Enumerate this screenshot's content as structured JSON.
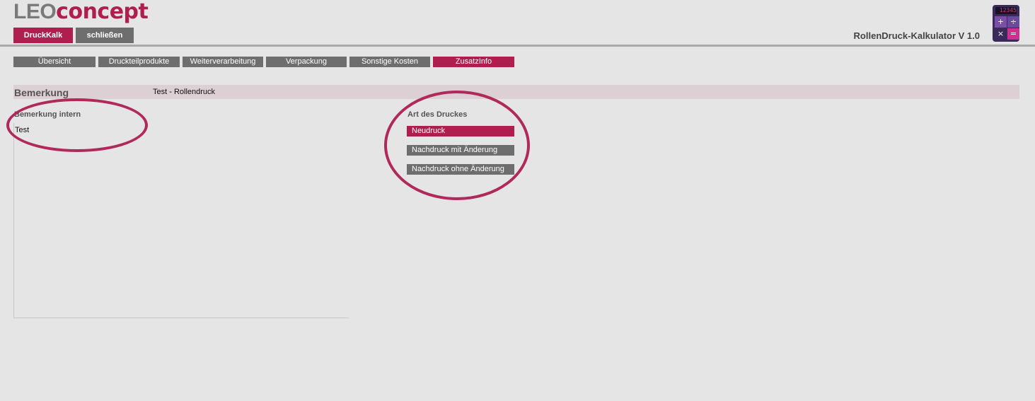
{
  "brand": {
    "logo_part1": "LEO",
    "logo_part2": "concept"
  },
  "header": {
    "primary_button": "DruckKalk",
    "secondary_button": "schließen",
    "app_title": "RollenDruck-Kalkulator V 1.0",
    "calc_display": "12345"
  },
  "tabs": [
    {
      "label": "Übersicht"
    },
    {
      "label": "Druckteilprodukte"
    },
    {
      "label": "Weiterverarbeitung"
    },
    {
      "label": "Verpackung"
    },
    {
      "label": "Sonstige Kosten"
    },
    {
      "label": "ZusatzInfo",
      "active": true
    }
  ],
  "remark": {
    "label": "Bemerkung",
    "value": "Test - Rollendruck"
  },
  "intern": {
    "label": "Bemerkung intern",
    "value": "Test"
  },
  "art": {
    "label": "Art des Druckes",
    "options": [
      {
        "label": "Neudruck",
        "selected": true
      },
      {
        "label": "Nachdruck mit Änderung"
      },
      {
        "label": "Nachdruck ohne Änderung"
      }
    ]
  },
  "colors": {
    "accent": "#b01e4f",
    "button_gray": "#6e6e6e",
    "background": "#e5e5e5",
    "highlight_ring": "#b0295a"
  }
}
